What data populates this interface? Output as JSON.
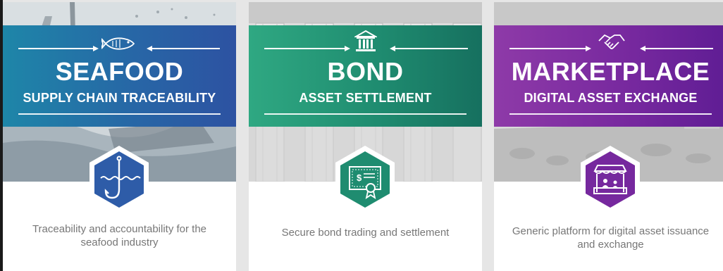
{
  "cards": [
    {
      "title": "SEAFOOD",
      "subtitle": "SUPPLY CHAIN TRACEABILITY",
      "description": "Traceability and accountability for the seafood industry",
      "band_icon": "fish-icon",
      "badge_icon": "fishing-hook-icon",
      "accent": "#2767a6"
    },
    {
      "title": "BOND",
      "subtitle": "ASSET SETTLEMENT",
      "description": "Secure bond trading and settlement",
      "band_icon": "bank-building-icon",
      "badge_icon": "certificate-icon",
      "accent": "#1f8c70"
    },
    {
      "title": "MARKETPLACE",
      "subtitle": "DIGITAL ASSET EXCHANGE",
      "description": "Generic platform for digital asset issuance and exchange",
      "band_icon": "handshake-icon",
      "badge_icon": "market-stall-icon",
      "accent": "#76289e"
    }
  ]
}
